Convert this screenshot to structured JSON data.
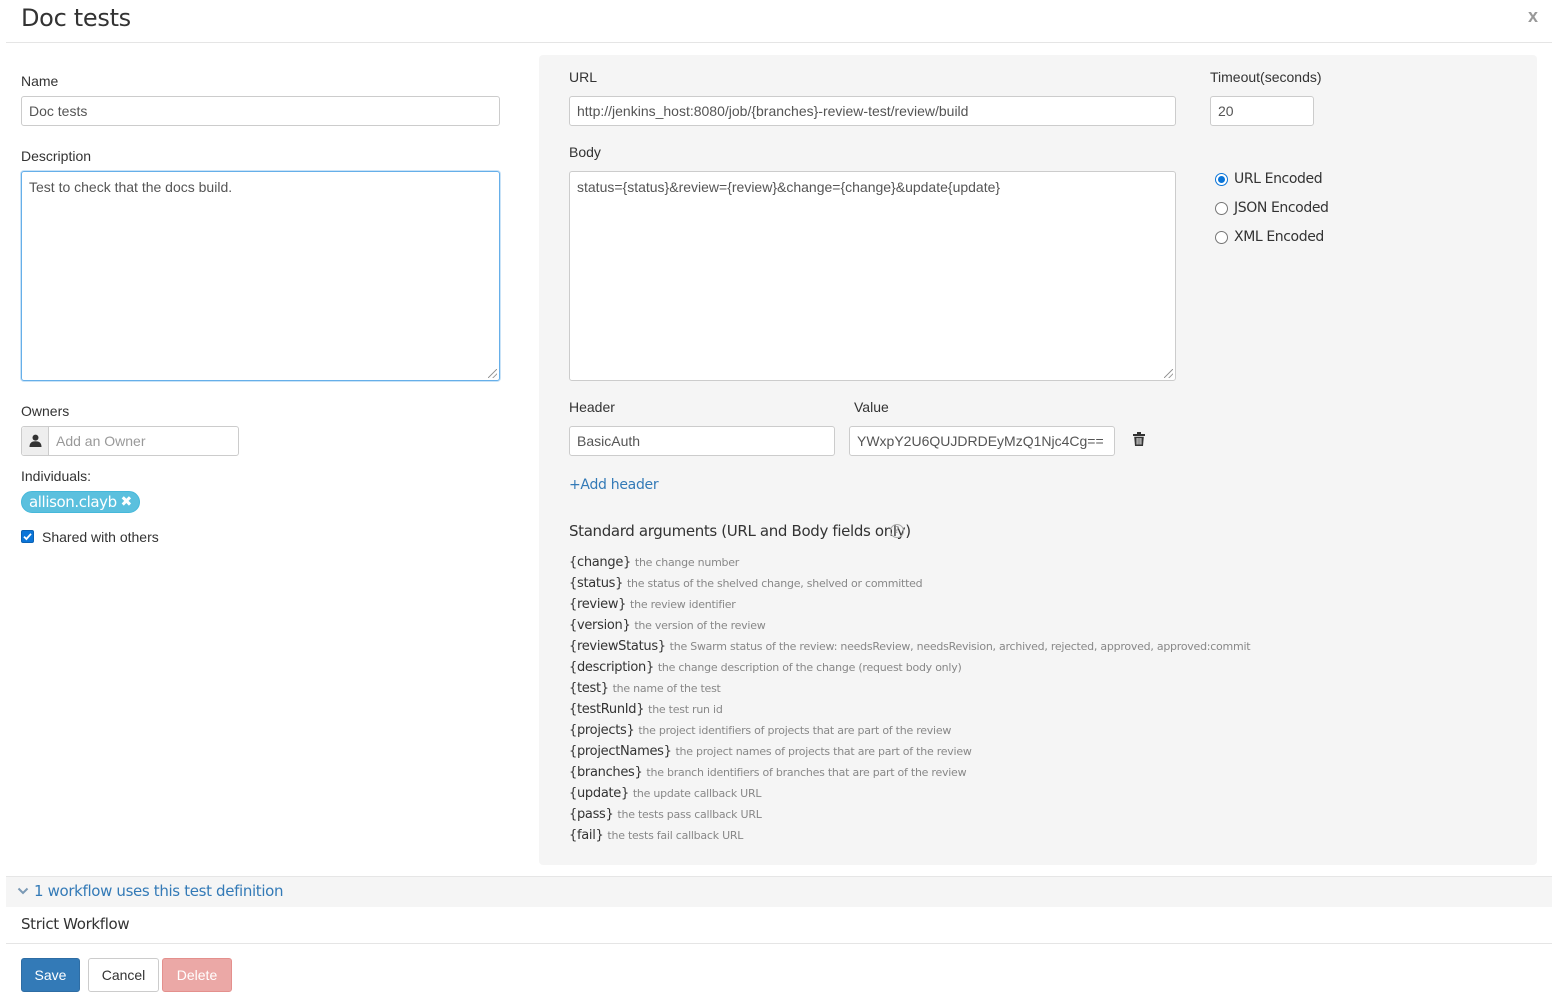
{
  "modal": {
    "title": "Doc tests",
    "close_label": "x"
  },
  "left": {
    "name_label": "Name",
    "name_value": "Doc tests",
    "description_label": "Description",
    "description_value": "Test to check that the docs build.",
    "owners_label": "Owners",
    "owners_placeholder": "Add an Owner",
    "individuals_label": "Individuals:",
    "individuals": [
      {
        "name": "allison.clayb",
        "remove_label": "✖"
      }
    ],
    "shared_label": "Shared with others",
    "shared_checked": true
  },
  "right": {
    "url_label": "URL",
    "url_value": "http://jenkins_host:8080/job/{branches}-review-test/review/build",
    "timeout_label": "Timeout(seconds)",
    "timeout_value": "20",
    "body_label": "Body",
    "body_value": "status={status}&review={review}&change={change}&update{update}",
    "encodings": [
      {
        "label": "URL Encoded",
        "checked": true
      },
      {
        "label": "JSON Encoded",
        "checked": false
      },
      {
        "label": "XML Encoded",
        "checked": false
      }
    ],
    "header_label": "Header",
    "value_label": "Value",
    "headers": [
      {
        "header": "BasicAuth",
        "value": "YWxpY2U6QUJDRDEyMzQ1Njc4Cg=="
      }
    ],
    "add_header_label": "+Add header",
    "std_args_title": "Standard arguments (URL and Body fields only)",
    "help_icon_glyph": "?",
    "std_args": [
      {
        "name": "{change}",
        "desc": "the change number"
      },
      {
        "name": "{status}",
        "desc": "the status of the shelved change, shelved or committed"
      },
      {
        "name": "{review}",
        "desc": "the review identifier"
      },
      {
        "name": "{version}",
        "desc": "the version of the review"
      },
      {
        "name": "{reviewStatus}",
        "desc": "the Swarm status of the review: needsReview, needsRevision, archived, rejected, approved, approved:commit"
      },
      {
        "name": "{description}",
        "desc": "the change description of the change (request body only)"
      },
      {
        "name": "{test}",
        "desc": "the name of the test"
      },
      {
        "name": "{testRunId}",
        "desc": "the test run id"
      },
      {
        "name": "{projects}",
        "desc": "the project identifiers of projects that are part of the review"
      },
      {
        "name": "{projectNames}",
        "desc": "the project names of projects that are part of the review"
      },
      {
        "name": "{branches}",
        "desc": "the branch identifiers of branches that are part of the review"
      },
      {
        "name": "{update}",
        "desc": "the update callback URL"
      },
      {
        "name": "{pass}",
        "desc": "the tests pass callback URL"
      },
      {
        "name": "{fail}",
        "desc": "the tests fail callback URL"
      }
    ]
  },
  "workflows": {
    "toggle_label": "1 workflow uses this test definition",
    "items": [
      "Strict Workflow"
    ]
  },
  "actions": {
    "save_label": "Save",
    "cancel_label": "Cancel",
    "delete_label": "Delete"
  },
  "colors": {
    "primary": "#337ab7",
    "chip": "#5bc0de",
    "danger_disabled": "#eba8a6",
    "panel_bg": "#f5f5f5",
    "focus": "#66afe9"
  },
  "icons": [
    "close-icon",
    "user-icon",
    "remove-icon",
    "checkbox-checked-icon",
    "trash-icon",
    "help-icon",
    "chevron-down-icon"
  ]
}
